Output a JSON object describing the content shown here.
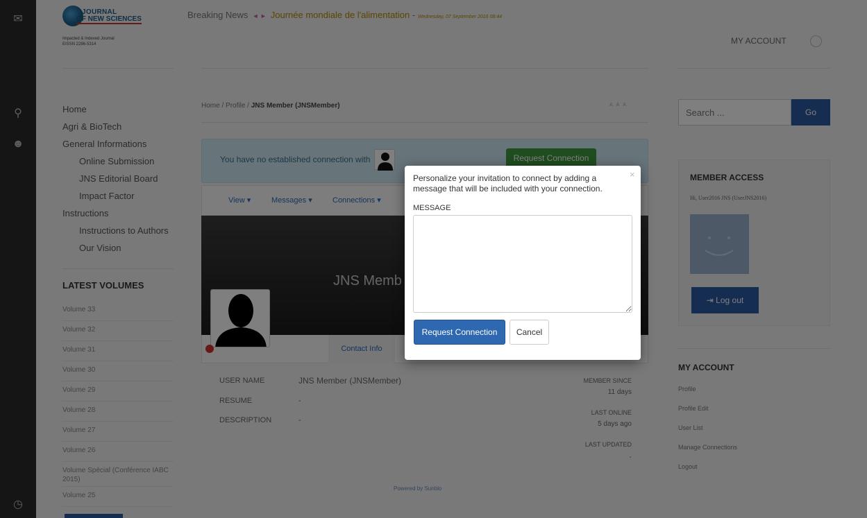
{
  "logo": {
    "line1": "JOURNAL",
    "line2": "OF NEW SCIENCES",
    "tag1": "Impacted & Indexed Journal",
    "tag2": "EISSN 2286-5314"
  },
  "header": {
    "news_label": "Breaking News",
    "headline": "Journée mondiale de l'alimentation",
    "date": "Wednesday, 07 September 2016 08:44",
    "my_account": "MY ACCOUNT"
  },
  "leftnav": [
    {
      "label": "Home",
      "sub": false
    },
    {
      "label": "Agri & BioTech",
      "sub": false
    },
    {
      "label": "General Informations",
      "sub": false
    },
    {
      "label": "Online Submission",
      "sub": true
    },
    {
      "label": "JNS Editorial Board",
      "sub": true
    },
    {
      "label": "Impact Factor",
      "sub": true
    },
    {
      "label": "Instructions",
      "sub": false
    },
    {
      "label": "Instructions to Authors",
      "sub": true
    },
    {
      "label": "Our Vision",
      "sub": true
    }
  ],
  "volumes": {
    "title": "LATEST VOLUMES",
    "items": [
      "Volume 33",
      "Volume 32",
      "Volume 31",
      "Volume 30",
      "Volume 29",
      "Volume 28",
      "Volume 27",
      "Volume 26",
      "Volume Spécial (Conférence IABC 2015)",
      "Volume 25"
    ]
  },
  "breadcrumb": {
    "home": "Home",
    "profile": "Profile",
    "current": "JNS Member (JNSMember)",
    "sep": "/"
  },
  "alert": {
    "text": "You have no established connection with",
    "button": "Request Connection"
  },
  "profile_menu": {
    "view": "View ▾",
    "messages": "Messages ▾",
    "connections": "Connections ▾"
  },
  "profile": {
    "cover_name": "JNS Memb",
    "contact_tab": "Contact Info",
    "username_label": "USER NAME",
    "username_value": "JNS Member (JNSMember)",
    "resume_label": "RESUME",
    "resume_value": "-",
    "description_label": "DESCRIPTION",
    "description_value": "-",
    "member_since_label": "MEMBER SINCE",
    "member_since_value": "11 days",
    "last_online_label": "LAST ONLINE",
    "last_online_value": "5 days ago",
    "last_updated_label": "LAST UPDATED",
    "last_updated_value": "-",
    "powered": "Powered by Sunblo"
  },
  "search": {
    "placeholder": "Search ...",
    "go": "Go"
  },
  "member_access": {
    "title": "MEMBER ACCESS",
    "greeting": "Hi, User2016 JNS (UserJNS2016)",
    "logout": "Log out"
  },
  "my_account_menu": {
    "title": "MY ACCOUNT",
    "items": [
      "Profile",
      "Profile Edit",
      "User List",
      "Manage Connections",
      "Logout"
    ]
  },
  "modal": {
    "message": "Personalize your invitation to connect by adding a message that will be included with your connection.",
    "field_label": "MESSAGE",
    "field_value": "",
    "submit": "Request Connection",
    "cancel": "Cancel",
    "close": "×"
  },
  "colors": {
    "primary": "#2d68b0",
    "success": "#3f9a3f",
    "alert_bg": "#cfe9f5",
    "status_offline": "#d0312d"
  }
}
